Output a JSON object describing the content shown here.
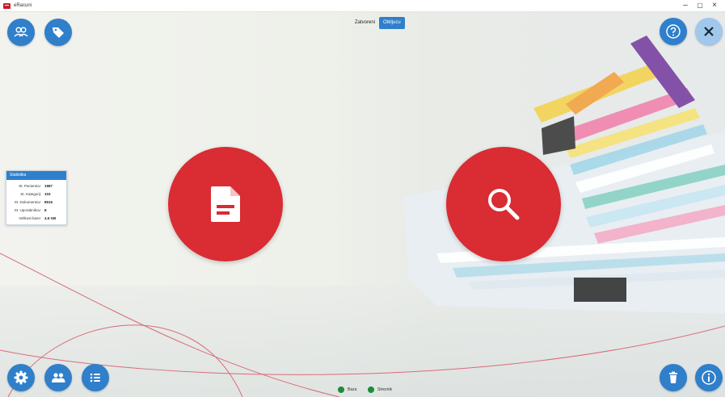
{
  "window": {
    "title": "eRacuni",
    "minimize": "–",
    "maximize": "▢",
    "close": "×"
  },
  "toggle": {
    "left": "Zatvoreni",
    "right": "Otkljucu"
  },
  "top_icons": {
    "users": "users-icon",
    "tags": "tag-icon",
    "help": "question-icon",
    "close": "close-icon"
  },
  "main": {
    "new_document": "document-icon",
    "search": "search-icon"
  },
  "stats": {
    "title": "Statistika",
    "rows": [
      {
        "label": "St. Pacientov:",
        "value": "1987"
      },
      {
        "label": "St. Kategorij:",
        "value": "103"
      },
      {
        "label": "St. Dokumentov:",
        "value": "8516"
      },
      {
        "label": "St. Uporabnikov:",
        "value": "8"
      },
      {
        "label": "Velikost baze:",
        "value": "4.6 GB"
      }
    ]
  },
  "bottom_icons": {
    "settings": "gear-icon",
    "group": "group-icon",
    "list": "list-icon",
    "delete": "trash-icon",
    "info": "info-icon"
  },
  "status": {
    "db": "Baza",
    "server": "Streznik"
  },
  "colors": {
    "accent": "#2f7fcb",
    "primary_red": "#d92c33",
    "status_ok": "#1e8a3c"
  }
}
